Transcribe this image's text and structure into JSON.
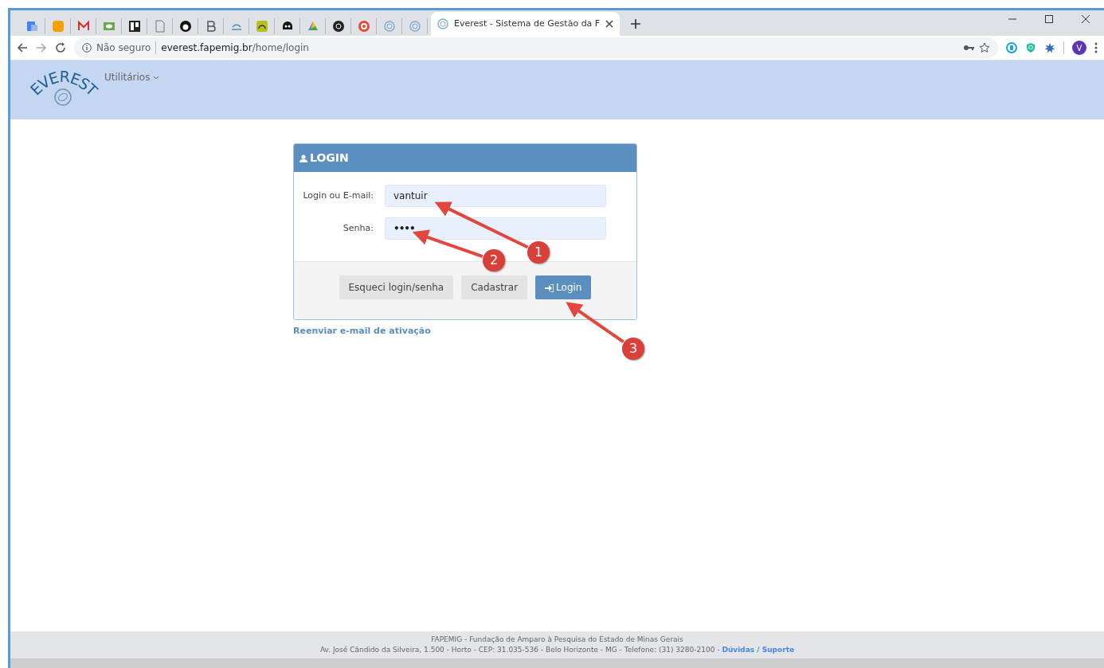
{
  "browser": {
    "tabs": [
      {
        "kind": "pinned",
        "selected": false
      },
      {
        "kind": "pinned",
        "selected": false
      },
      {
        "kind": "pinned",
        "selected": false
      },
      {
        "kind": "pinned",
        "selected": false
      },
      {
        "kind": "pinned",
        "selected": false
      },
      {
        "kind": "pinned",
        "selected": false
      },
      {
        "kind": "pinned",
        "selected": false
      },
      {
        "kind": "pinned",
        "selected": false
      },
      {
        "kind": "pinned",
        "selected": false
      },
      {
        "kind": "pinned",
        "selected": false
      },
      {
        "kind": "pinned",
        "selected": false
      },
      {
        "kind": "pinned",
        "selected": false
      },
      {
        "kind": "pinned",
        "selected": false
      },
      {
        "kind": "pinned",
        "selected": false
      },
      {
        "kind": "pinned",
        "selected": false
      },
      {
        "kind": "pinned",
        "selected": false
      },
      {
        "kind": "page",
        "title": "Everest - Sistema de Gestão da F",
        "selected": true
      }
    ],
    "security_label": "Não seguro",
    "url_host": "everest.fapemig.br",
    "url_path": "/home/login",
    "profile_initial": "V"
  },
  "navbar": {
    "logo_text": "EVEREST",
    "menu": "Utilitários"
  },
  "login": {
    "title": "LOGIN",
    "fields": [
      {
        "label": "Login ou E-mail:",
        "value": "vantuir",
        "kind": "text"
      },
      {
        "label": "Senha:",
        "value": "••••",
        "kind": "password"
      }
    ],
    "buttons": [
      {
        "label": "Esqueci login/senha",
        "kind": "secondary"
      },
      {
        "label": "Cadastrar",
        "kind": "secondary"
      },
      {
        "label": "Login",
        "kind": "primary"
      }
    ],
    "resend_link": "Reenviar e-mail de ativação"
  },
  "annotations": [
    {
      "label": "1"
    },
    {
      "label": "2"
    },
    {
      "label": "3"
    }
  ],
  "footer": {
    "line_1": "FAPEMIG - Fundação de Amparo à Pesquisa do Estado de Minas Gerais",
    "line_2": "Av. José Cândido da Silveira, 1.500 - Horto - CEP: 31.035-536 - Belo Horizonte - MG - Telefone: (31) 3280-2100 -",
    "support_link": "Dúvidas / Suporte"
  }
}
